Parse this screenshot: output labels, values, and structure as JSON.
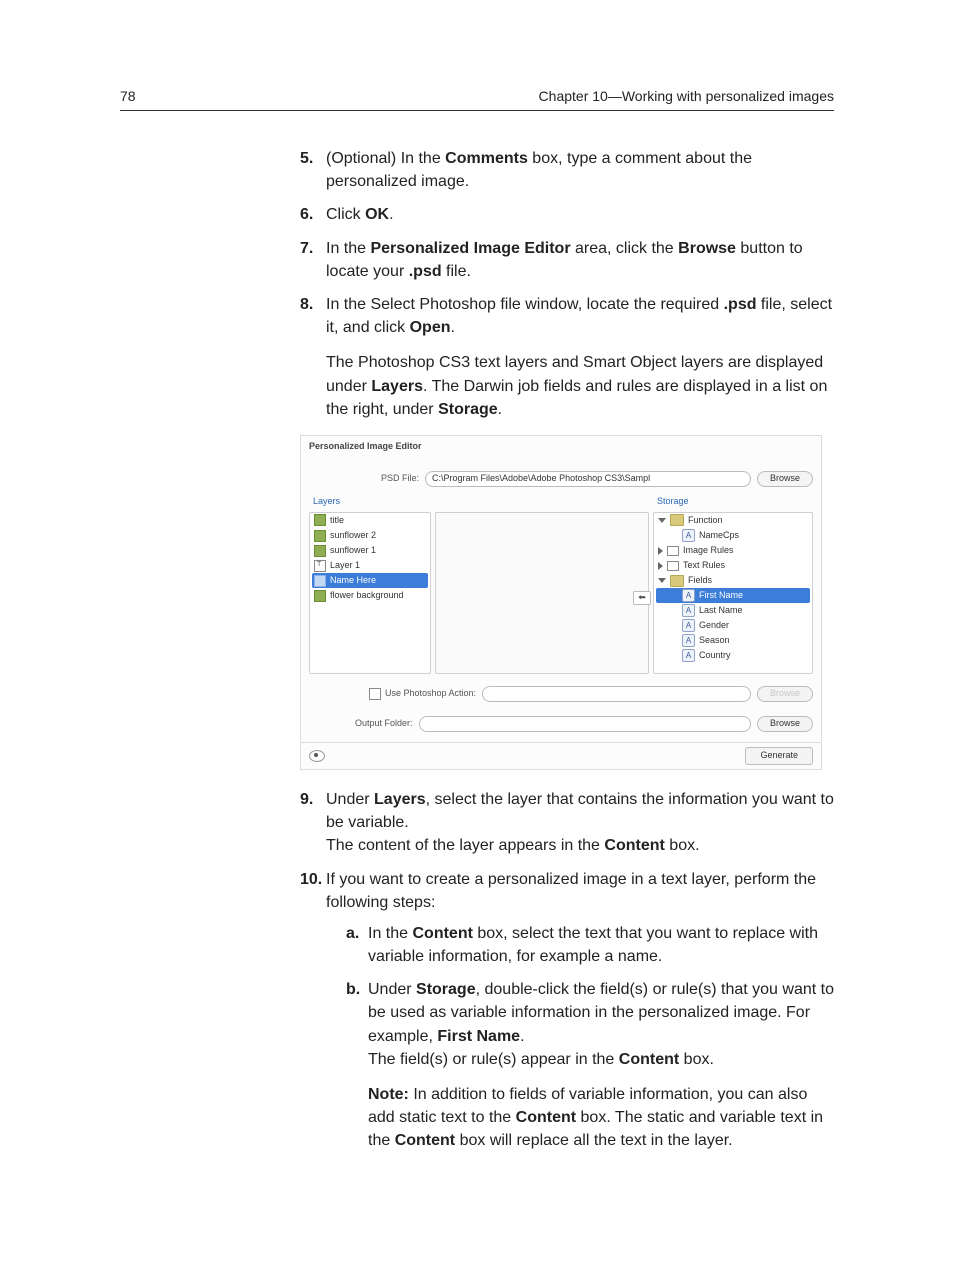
{
  "page_number": "78",
  "chapter": "Chapter 10—Working with personalized images",
  "steps": {
    "s5": {
      "num": "5.",
      "p1a": "(Optional) In the ",
      "p1b": "Comments",
      "p1c": " box, type a comment about the personalized image."
    },
    "s6": {
      "num": "6.",
      "p1a": "Click ",
      "p1b": "OK",
      "p1c": "."
    },
    "s7": {
      "num": "7.",
      "p1a": "In the ",
      "p1b": "Personalized Image Editor",
      "p1c": " area, click the ",
      "p1d": "Browse",
      "p1e": " button to locate your ",
      "p1f": ".psd",
      "p1g": " file."
    },
    "s8": {
      "num": "8.",
      "p1a": "In the Select Photoshop file window, locate the required ",
      "p1b": ".psd",
      "p1c": " file, select it, and click ",
      "p1d": "Open",
      "p1e": ".",
      "p2a": "The Photoshop CS3 text layers and Smart Object layers are displayed under ",
      "p2b": "Layers",
      "p2c": ". The Darwin job fields and rules are displayed in a list on the right, under ",
      "p2d": "Storage",
      "p2e": "."
    },
    "s9": {
      "num": "9.",
      "p1a": "Under ",
      "p1b": "Layers",
      "p1c": ", select the layer that contains the information you want to be variable.",
      "p2a": "The content of the layer appears in the ",
      "p2b": "Content",
      "p2c": " box."
    },
    "s10": {
      "num": "10.",
      "p1": "If you want to create a personalized image in a text layer, perform the following steps:",
      "a": {
        "num": "a.",
        "p1a": "In the ",
        "p1b": "Content",
        "p1c": " box, select the text that you want to replace with variable information, for example a name."
      },
      "b": {
        "num": "b.",
        "p1a": "Under ",
        "p1b": "Storage",
        "p1c": ", double-click the field(s) or rule(s) that you want to be used as variable information in the personalized image. For example, ",
        "p1d": "First Name",
        "p1e": ".",
        "p2a": "The field(s) or rule(s) appear in the ",
        "p2b": "Content",
        "p2c": " box.",
        "note_lbl": "Note:",
        "note": " In addition to fields of variable information, you can also add static text to the ",
        "note_b": "Content",
        "note2": " box. The static and variable text in the ",
        "note_b2": "Content",
        "note3": " box will replace all the text in the layer."
      }
    }
  },
  "shot": {
    "title": "Personalized Image Editor",
    "psd_label": "PSD File:",
    "psd_value": "C:\\Program Files\\Adobe\\Adobe Photoshop CS3\\Sampl",
    "browse": "Browse",
    "layers_title": "Layers",
    "layers": {
      "l0": "title",
      "l1": "sunflower 2",
      "l2": "sunflower 1",
      "l3": "Layer 1",
      "l4": "Name Here",
      "l5": "flower background"
    },
    "storage_title": "Storage",
    "storage": {
      "function": "Function",
      "namecps": "NameCps",
      "image_rules": "Image Rules",
      "text_rules": "Text Rules",
      "fields": "Fields",
      "first_name": "First Name",
      "last_name": "Last Name",
      "gender": "Gender",
      "season": "Season",
      "country": "Country"
    },
    "use_action": "Use Photoshop Action:",
    "output_folder": "Output Folder:",
    "generate": "Generate",
    "arrow": "⬅"
  }
}
